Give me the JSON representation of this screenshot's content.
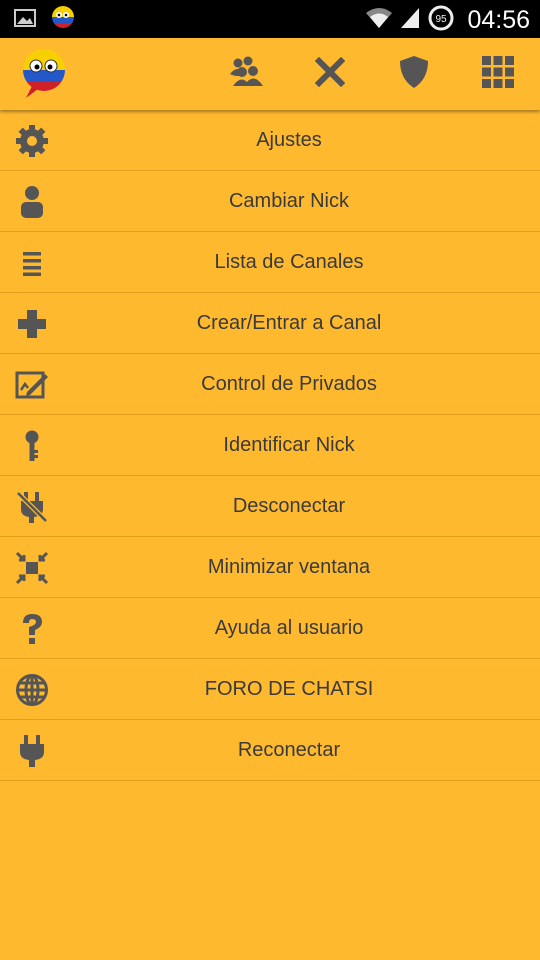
{
  "status_bar": {
    "time": "04:56",
    "battery_level": "95"
  },
  "toolbar": {
    "actions": [
      "users-icon",
      "close-icon",
      "shield-icon",
      "grid-icon"
    ]
  },
  "menu": {
    "items": [
      {
        "label": "Ajustes",
        "icon": "gear-icon"
      },
      {
        "label": "Cambiar Nick",
        "icon": "person-icon"
      },
      {
        "label": "Lista de Canales",
        "icon": "list-icon"
      },
      {
        "label": "Crear/Entrar a Canal",
        "icon": "plus-icon"
      },
      {
        "label": "Control de Privados",
        "icon": "edit-message-icon"
      },
      {
        "label": "Identificar Nick",
        "icon": "key-icon"
      },
      {
        "label": "Desconectar",
        "icon": "unplug-icon"
      },
      {
        "label": "Minimizar ventana",
        "icon": "minimize-icon"
      },
      {
        "label": "Ayuda al usuario",
        "icon": "question-icon"
      },
      {
        "label": "FORO DE CHATSI",
        "icon": "globe-icon"
      },
      {
        "label": "Reconectar",
        "icon": "plug-icon"
      }
    ]
  },
  "colors": {
    "background": "#FFB92F",
    "divider": "#E29F1C",
    "icon": "#555555",
    "text": "#3a3a3a"
  }
}
